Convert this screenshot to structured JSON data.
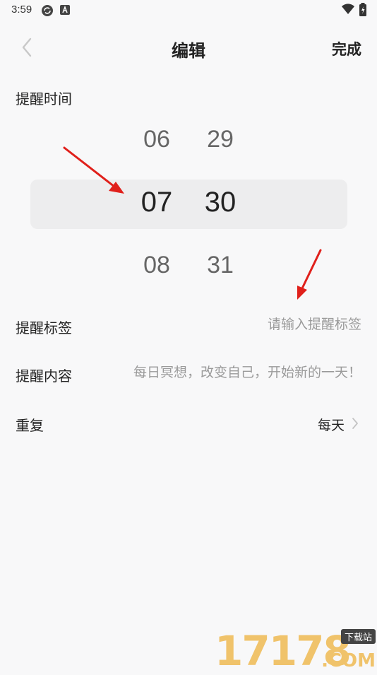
{
  "status_bar": {
    "time": "3:59",
    "icons": [
      "sync-app-icon",
      "a-app-icon",
      "wifi-icon",
      "battery-icon"
    ]
  },
  "header": {
    "title": "编辑",
    "done_label": "完成",
    "back_icon": "chevron-left-icon"
  },
  "reminder_time": {
    "label": "提醒时间",
    "hour": {
      "prev": "06",
      "selected": "07",
      "next": "08"
    },
    "minute": {
      "prev": "29",
      "selected": "30",
      "next": "31"
    }
  },
  "tag": {
    "label": "提醒标签",
    "placeholder": "请输入提醒标签",
    "value": ""
  },
  "content": {
    "label": "提醒内容",
    "placeholder": "每日冥想，改变自己，开始新的一天！",
    "value": ""
  },
  "repeat": {
    "label": "重复",
    "value": "每天",
    "chevron_icon": "chevron-right-icon"
  },
  "watermark": {
    "digits": "17178",
    "badge": "下载站",
    "suffix": ".COM"
  },
  "colors": {
    "background": "#f8f8f9",
    "picker_highlight": "#ededee",
    "annotation_arrow": "#e0201b",
    "watermark": "#f0c36b"
  }
}
